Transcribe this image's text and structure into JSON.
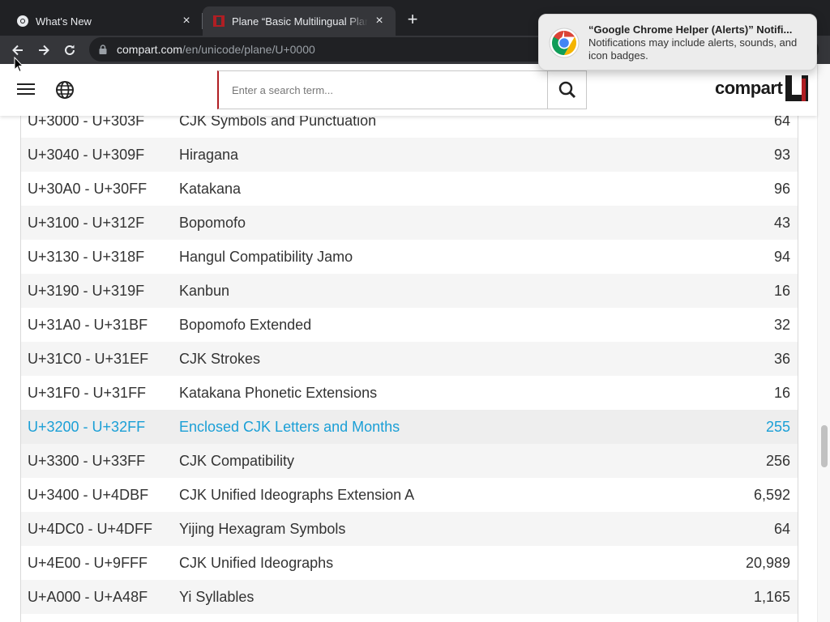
{
  "browser": {
    "tabs": [
      {
        "title": "What's New",
        "active": false
      },
      {
        "title": "Plane “Basic Multilingual Plane”",
        "active": true
      }
    ],
    "url_host": "compart.com",
    "url_path": "/en/unicode/plane/U+0000"
  },
  "site": {
    "search_placeholder": "Enter a search term...",
    "logo_text": "compart"
  },
  "table": {
    "rows": [
      {
        "range": "U+3000 - U+303F",
        "name": "CJK Symbols and Punctuation",
        "count": "64"
      },
      {
        "range": "U+3040 - U+309F",
        "name": "Hiragana",
        "count": "93"
      },
      {
        "range": "U+30A0 - U+30FF",
        "name": "Katakana",
        "count": "96"
      },
      {
        "range": "U+3100 - U+312F",
        "name": "Bopomofo",
        "count": "43"
      },
      {
        "range": "U+3130 - U+318F",
        "name": "Hangul Compatibility Jamo",
        "count": "94"
      },
      {
        "range": "U+3190 - U+319F",
        "name": "Kanbun",
        "count": "16"
      },
      {
        "range": "U+31A0 - U+31BF",
        "name": "Bopomofo Extended",
        "count": "32"
      },
      {
        "range": "U+31C0 - U+31EF",
        "name": "CJK Strokes",
        "count": "36"
      },
      {
        "range": "U+31F0 - U+31FF",
        "name": "Katakana Phonetic Extensions",
        "count": "16"
      },
      {
        "range": "U+3200 - U+32FF",
        "name": "Enclosed CJK Letters and Months",
        "count": "255"
      },
      {
        "range": "U+3300 - U+33FF",
        "name": "CJK Compatibility",
        "count": "256"
      },
      {
        "range": "U+3400 - U+4DBF",
        "name": "CJK Unified Ideographs Extension A",
        "count": "6,592"
      },
      {
        "range": "U+4DC0 - U+4DFF",
        "name": "Yijing Hexagram Symbols",
        "count": "64"
      },
      {
        "range": "U+4E00 - U+9FFF",
        "name": "CJK Unified Ideographs",
        "count": "20,989"
      },
      {
        "range": "U+A000 - U+A48F",
        "name": "Yi Syllables",
        "count": "1,165"
      }
    ]
  },
  "notification": {
    "title": "“Google Chrome Helper (Alerts)” Notifi...",
    "body": "Notifications may include alerts, sounds, and icon badges."
  },
  "colors": {
    "link_active": "#1a9fd6",
    "brand_red": "#b01e23"
  }
}
